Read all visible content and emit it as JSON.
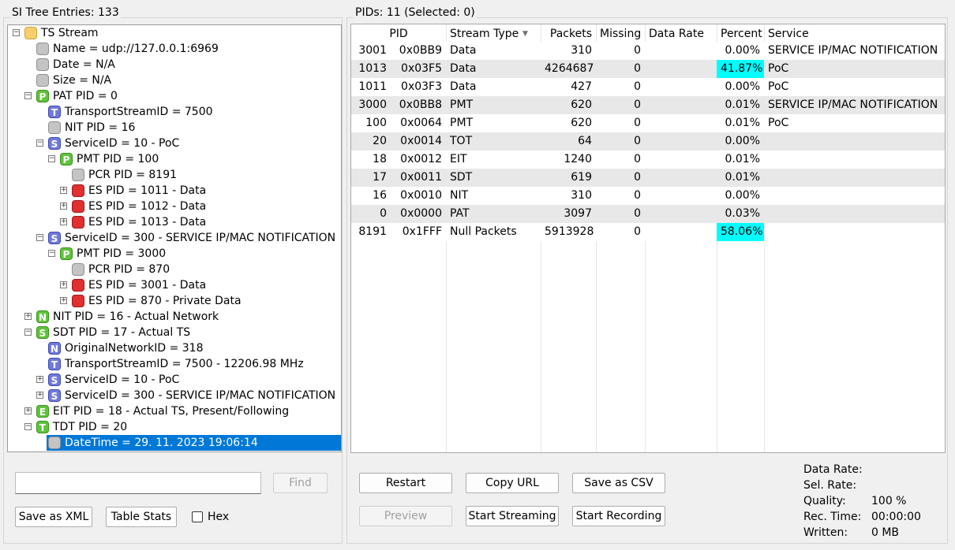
{
  "left_panel": {
    "title": "SI Tree Entries: 133",
    "tree": [
      {
        "label": "TS Stream",
        "icon": "folder-icon",
        "letter": ""
      },
      {
        "label": "Name = udp://127.0.0.1:6969",
        "icon": "gray-node-icon",
        "letter": ""
      },
      {
        "label": "Date = N/A",
        "icon": "gray-node-icon",
        "letter": ""
      },
      {
        "label": "Size = N/A",
        "icon": "gray-node-icon",
        "letter": ""
      },
      {
        "label": "PAT PID = 0",
        "icon": "green-p-icon",
        "letter": "P"
      },
      {
        "label": "TransportStreamID = 7500",
        "icon": "blue-t-icon",
        "letter": "T"
      },
      {
        "label": "NIT PID = 16",
        "icon": "gray-node-icon",
        "letter": ""
      },
      {
        "label": "ServiceID = 10 - PoC",
        "icon": "blue-s-icon",
        "letter": "S"
      },
      {
        "label": "PMT PID = 100",
        "icon": "green-p-icon",
        "letter": "P"
      },
      {
        "label": "PCR PID = 8191",
        "icon": "gray-node-icon",
        "letter": ""
      },
      {
        "label": "ES PID = 1011 - Data",
        "icon": "red-node-icon",
        "letter": ""
      },
      {
        "label": "ES PID = 1012 - Data",
        "icon": "red-node-icon",
        "letter": ""
      },
      {
        "label": "ES PID = 1013 - Data",
        "icon": "red-node-icon",
        "letter": ""
      },
      {
        "label": "ServiceID = 300 - SERVICE IP/MAC NOTIFICATION",
        "icon": "blue-s-icon",
        "letter": "S"
      },
      {
        "label": "PMT PID = 3000",
        "icon": "green-p-icon",
        "letter": "P"
      },
      {
        "label": "PCR PID = 870",
        "icon": "gray-node-icon",
        "letter": ""
      },
      {
        "label": "ES PID = 3001 - Data",
        "icon": "red-node-icon",
        "letter": ""
      },
      {
        "label": "ES PID = 870 - Private Data",
        "icon": "red-node-icon",
        "letter": ""
      },
      {
        "label": "NIT PID = 16 - Actual Network",
        "icon": "green-n-icon",
        "letter": "N"
      },
      {
        "label": "SDT PID = 17 - Actual TS",
        "icon": "green-s-icon",
        "letter": "S"
      },
      {
        "label": "OriginalNetworkID = 318",
        "icon": "blue-n-icon",
        "letter": "N"
      },
      {
        "label": "TransportStreamID = 7500 - 12206.98 MHz",
        "icon": "blue-t-icon",
        "letter": "T"
      },
      {
        "label": "ServiceID = 10 - PoC",
        "icon": "blue-s-icon",
        "letter": "S"
      },
      {
        "label": "ServiceID = 300 - SERVICE IP/MAC NOTIFICATION",
        "icon": "blue-s-icon",
        "letter": "S"
      },
      {
        "label": "EIT PID = 18 - Actual TS, Present/Following",
        "icon": "green-e-icon",
        "letter": "E"
      },
      {
        "label": "TDT PID = 20",
        "icon": "green-t-icon",
        "letter": "T"
      },
      {
        "label": "DateTime = 29. 11. 2023 19:06:14",
        "icon": "gray-node-icon",
        "letter": ""
      }
    ],
    "search_value": "",
    "find_label": "Find",
    "save_xml_label": "Save as XML",
    "table_stats_label": "Table Stats",
    "hex_label": "Hex",
    "hex_checked": false
  },
  "right_panel": {
    "title": "PIDs: 11   (Selected: 0)",
    "columns": [
      "PID",
      "Stream Type",
      "Packets",
      "Missing",
      "Data Rate",
      "Percent",
      "Service"
    ],
    "sort_indicator": "▼",
    "highlight_color": "#00ffff",
    "rows": [
      {
        "pid": "3001",
        "hex": "0x0BB9",
        "type": "Data",
        "packets": "310",
        "missing": "0",
        "rate": "",
        "percent": "0.00%",
        "service": "SERVICE IP/MAC NOTIFICATION",
        "pct_value": 0.0
      },
      {
        "pid": "1013",
        "hex": "0x03F5",
        "type": "Data",
        "packets": "4264687",
        "missing": "0",
        "rate": "",
        "percent": "41.87%",
        "service": "PoC",
        "pct_value": 41.87
      },
      {
        "pid": "1011",
        "hex": "0x03F3",
        "type": "Data",
        "packets": "427",
        "missing": "0",
        "rate": "",
        "percent": "0.00%",
        "service": "PoC",
        "pct_value": 0.0
      },
      {
        "pid": "3000",
        "hex": "0x0BB8",
        "type": "PMT",
        "packets": "620",
        "missing": "0",
        "rate": "",
        "percent": "0.01%",
        "service": "SERVICE IP/MAC NOTIFICATION",
        "pct_value": 0.01
      },
      {
        "pid": "100",
        "hex": "0x0064",
        "type": "PMT",
        "packets": "620",
        "missing": "0",
        "rate": "",
        "percent": "0.01%",
        "service": "PoC",
        "pct_value": 0.01
      },
      {
        "pid": "20",
        "hex": "0x0014",
        "type": "TOT",
        "packets": "64",
        "missing": "0",
        "rate": "",
        "percent": "0.00%",
        "service": "",
        "pct_value": 0.0
      },
      {
        "pid": "18",
        "hex": "0x0012",
        "type": "EIT",
        "packets": "1240",
        "missing": "0",
        "rate": "",
        "percent": "0.01%",
        "service": "",
        "pct_value": 0.01
      },
      {
        "pid": "17",
        "hex": "0x0011",
        "type": "SDT",
        "packets": "619",
        "missing": "0",
        "rate": "",
        "percent": "0.01%",
        "service": "",
        "pct_value": 0.01
      },
      {
        "pid": "16",
        "hex": "0x0010",
        "type": "NIT",
        "packets": "310",
        "missing": "0",
        "rate": "",
        "percent": "0.00%",
        "service": "",
        "pct_value": 0.0
      },
      {
        "pid": "0",
        "hex": "0x0000",
        "type": "PAT",
        "packets": "3097",
        "missing": "0",
        "rate": "",
        "percent": "0.03%",
        "service": "",
        "pct_value": 0.03
      },
      {
        "pid": "8191",
        "hex": "0x1FFF",
        "type": "Null Packets",
        "packets": "5913928",
        "missing": "0",
        "rate": "",
        "percent": "58.06%",
        "service": "",
        "pct_value": 58.06
      }
    ],
    "buttons": {
      "restart": "Restart",
      "copy_url": "Copy URL",
      "save_csv": "Save as CSV",
      "preview": "Preview",
      "start_streaming": "Start Streaming",
      "start_recording": "Start Recording"
    },
    "stats": {
      "data_rate_label": "Data Rate:",
      "data_rate_value": "",
      "sel_rate_label": "Sel. Rate:",
      "sel_rate_value": "",
      "quality_label": "Quality:",
      "quality_value": "100 %",
      "rec_time_label": "Rec. Time:",
      "rec_time_value": "00:00:00",
      "written_label": "Written:",
      "written_value": "0 MB"
    }
  }
}
